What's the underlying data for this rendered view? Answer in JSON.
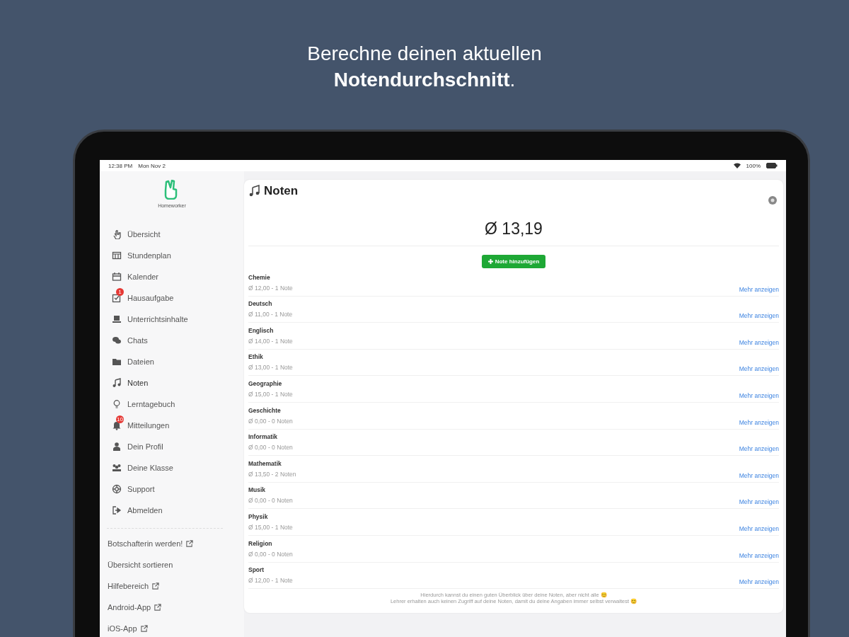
{
  "headline": {
    "line_1": "Berechne deinen aktuellen",
    "line_2": "Notendurchschnitt",
    "line_2_end": "."
  },
  "status_bar": {
    "time": "12:38 PM",
    "date": "Mon Nov 2",
    "battery": "100%"
  },
  "app_name": "Homeworker",
  "sidebar": {
    "items": [
      {
        "label": "Übersicht",
        "selected": false
      },
      {
        "label": "Stundenplan",
        "selected": false
      },
      {
        "label": "Kalender",
        "selected": false
      },
      {
        "label": "Hausaufgabe",
        "selected": false,
        "badge": "1"
      },
      {
        "label": "Unterrichtsinhalte",
        "selected": false
      },
      {
        "label": "Chats",
        "selected": false
      },
      {
        "label": "Dateien",
        "selected": false
      },
      {
        "label": "Noten",
        "selected": true
      },
      {
        "label": "Lerntagebuch",
        "selected": false
      },
      {
        "label": "Mitteilungen",
        "selected": false,
        "badge": "10"
      },
      {
        "label": "Dein Profil",
        "selected": false
      },
      {
        "label": "Deine Klasse",
        "selected": false
      },
      {
        "label": "Support",
        "selected": false
      },
      {
        "label": "Abmelden",
        "selected": false
      }
    ],
    "links": [
      {
        "label": "Botschafterin werden!",
        "external": true
      },
      {
        "label": "Übersicht sortieren",
        "external": false
      },
      {
        "label": "Hilfebereich",
        "external": true
      },
      {
        "label": "Android-App",
        "external": true
      },
      {
        "label": "iOS-App",
        "external": true
      }
    ]
  },
  "grades": {
    "title": "Noten",
    "average": "Ø 13,19",
    "add_button": "Note hinzufügen",
    "subjects": [
      {
        "name": "Chemie",
        "summary": "Ø 12,00 - 1 Note",
        "link": "Mehr anzeigen"
      },
      {
        "name": "Deutsch",
        "summary": "Ø 11,00 - 1 Note",
        "link": "Mehr anzeigen"
      },
      {
        "name": "Englisch",
        "summary": "Ø 14,00 - 1 Note",
        "link": "Mehr anzeigen"
      },
      {
        "name": "Ethik",
        "summary": "Ø 13,00 - 1 Note",
        "link": "Mehr anzeigen"
      },
      {
        "name": "Geographie",
        "summary": "Ø 15,00 - 1 Note",
        "link": "Mehr anzeigen"
      },
      {
        "name": "Geschichte",
        "summary": "Ø 0,00 - 0 Noten",
        "link": "Mehr anzeigen"
      },
      {
        "name": "Informatik",
        "summary": "Ø 0,00 - 0 Noten",
        "link": "Mehr anzeigen"
      },
      {
        "name": "Mathematik",
        "summary": "Ø 13,50 - 2 Noten",
        "link": "Mehr anzeigen"
      },
      {
        "name": "Musik",
        "summary": "Ø 0,00 - 0 Noten",
        "link": "Mehr anzeigen"
      },
      {
        "name": "Physik",
        "summary": "Ø 15,00 - 1 Note",
        "link": "Mehr anzeigen"
      },
      {
        "name": "Religion",
        "summary": "Ø 0,00 - 0 Noten",
        "link": "Mehr anzeigen"
      },
      {
        "name": "Sport",
        "summary": "Ø 12,00 - 1 Note",
        "link": "Mehr anzeigen"
      }
    ],
    "footer": [
      "Hierdurch kannst du einen guten Überblick über deine Noten, aber nicht alle 😊",
      "Lehrer erhalten auch keinen Zugriff auf deine Noten, damit du deine Angaben immer selbst verwaltest 😊"
    ]
  }
}
